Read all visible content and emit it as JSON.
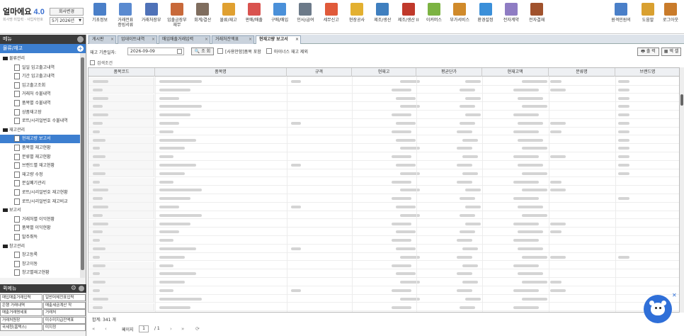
{
  "app": {
    "logo_main": "얼마에요",
    "logo_ver": "4.0",
    "logo_sub": "회사명 미입력 · 사업자번호",
    "company_btn": "회사변경",
    "period": "5기 2026년"
  },
  "toolbar": [
    {
      "label": "기초정보",
      "icon": "basic-info-icon",
      "color": "#4a7fc8"
    },
    {
      "label": "거래전표\n증빙서류",
      "icon": "voucher-icon",
      "color": "#5a8ad0"
    },
    {
      "label": "거래처장부",
      "icon": "ledger-icon",
      "color": "#4f72b8"
    },
    {
      "label": "입출금장부\n재무",
      "icon": "bank-icon",
      "color": "#c8693a"
    },
    {
      "label": "회계/결산",
      "icon": "accounting-icon",
      "color": "#7f6d5e"
    },
    {
      "label": "물류/재고",
      "icon": "logistics-icon",
      "color": "#e0a030"
    },
    {
      "label": "판매/매출",
      "icon": "sales-icon",
      "color": "#d9534f"
    },
    {
      "label": "구매/매입",
      "icon": "purchase-icon",
      "color": "#4a90d9"
    },
    {
      "label": "인사/급여",
      "icon": "hr-icon",
      "color": "#6c7a89"
    },
    {
      "label": "세무신고",
      "icon": "tax-icon",
      "color": "#e05a3a"
    },
    {
      "label": "현장공사",
      "icon": "construction-icon",
      "color": "#e3b030"
    },
    {
      "label": "제조/생산",
      "icon": "manufacture-icon",
      "color": "#3f7fbf"
    },
    {
      "label": "제조/생산 II",
      "icon": "manufacture2-icon",
      "color": "#c0392b"
    },
    {
      "label": "이커머스",
      "icon": "ecommerce-icon",
      "color": "#7cb342"
    },
    {
      "label": "부가서비스",
      "icon": "service-icon",
      "color": "#d08a2a"
    },
    {
      "label": "환경설정",
      "icon": "settings-icon",
      "color": "#3a8fd9"
    },
    {
      "label": "전자계약",
      "icon": "contract-icon",
      "color": "#8e7cc3"
    },
    {
      "label": "전자결재",
      "icon": "approval-icon",
      "color": "#a0522d"
    }
  ],
  "toolbar_right": [
    {
      "label": "원격민원의",
      "icon": "remote-support-icon",
      "color": "#4a7fc8"
    },
    {
      "label": "도움말",
      "icon": "help-icon",
      "color": "#d9a030"
    },
    {
      "label": "로그아웃",
      "icon": "logout-icon",
      "color": "#c97b2a"
    }
  ],
  "tabs": [
    {
      "label": "게시판",
      "active": false
    },
    {
      "label": "업데이트내역",
      "active": false
    },
    {
      "label": "매입매출거래입력",
      "active": false
    },
    {
      "label": "거래처잔액표",
      "active": false
    },
    {
      "label": "현재고량 보고서",
      "active": true
    }
  ],
  "sidebar": {
    "title": "메뉴",
    "selected_module": "물류/재고",
    "tree": [
      {
        "label": "물류관리",
        "type": "group"
      },
      {
        "label": "일일 입고출고내역",
        "type": "leaf"
      },
      {
        "label": "기간 입고출고내역",
        "type": "leaf"
      },
      {
        "label": "입고출고조회",
        "type": "leaf"
      },
      {
        "label": "거래처 수불내역",
        "type": "leaf"
      },
      {
        "label": "품목별 수불내역",
        "type": "leaf"
      },
      {
        "label": "상품재고장",
        "type": "leaf"
      },
      {
        "label": "로트/시리얼번호 수불내역",
        "type": "leaf"
      },
      {
        "label": "재고관리",
        "type": "group"
      },
      {
        "label": "현재고량 보고서",
        "type": "leaf",
        "selected": true
      },
      {
        "label": "품목별 재고현황",
        "type": "leaf"
      },
      {
        "label": "분류별 재고현황",
        "type": "leaf"
      },
      {
        "label": "브랜드별 재고현황",
        "type": "leaf"
      },
      {
        "label": "재고량 수정",
        "type": "leaf"
      },
      {
        "label": "분실폐기관리",
        "type": "leaf"
      },
      {
        "label": "로트/시리얼번호 재고현황",
        "type": "leaf"
      },
      {
        "label": "로트/시리얼번호 재고비교",
        "type": "leaf"
      },
      {
        "label": "보고서",
        "type": "group"
      },
      {
        "label": "거래처별 이익현황",
        "type": "leaf"
      },
      {
        "label": "품목별 이익현황",
        "type": "leaf"
      },
      {
        "label": "발주취득",
        "type": "leaf"
      },
      {
        "label": "창고관리",
        "type": "group"
      },
      {
        "label": "창고등록",
        "type": "leaf"
      },
      {
        "label": "창고이동",
        "type": "leaf"
      },
      {
        "label": "창고별재고현황",
        "type": "leaf"
      }
    ]
  },
  "quickmenu": {
    "title": "퀵메뉴",
    "items": [
      "매입매출거래입력",
      "일반머체전표입력",
      "은행 거래내역",
      "매출세금계산 작",
      "매출거래명세표",
      "거래처",
      "거래처원장",
      "미수미지급잔액표",
      "국세청(홈택스)",
      "미지정"
    ]
  },
  "filter": {
    "date_label": "재고 기준일자:",
    "date_value": "2026-09-09",
    "search_label": "조 회",
    "opt1": "[사용안함]품목 포함",
    "opt2": "마이너스 재고 제외",
    "print_label": "출 력",
    "excel_label": "엑 셀",
    "cond_label": "검색조건"
  },
  "grid": {
    "columns": [
      "품목코드",
      "품목명",
      "규격",
      "현재고",
      "평균단가",
      "현재고액",
      "분류명",
      "브랜드명"
    ],
    "row_count": 28
  },
  "footer": {
    "total_label": "합계:",
    "total_value": "341 개",
    "page_label": "페이지",
    "page_value": "1",
    "page_total": "/ 1"
  }
}
